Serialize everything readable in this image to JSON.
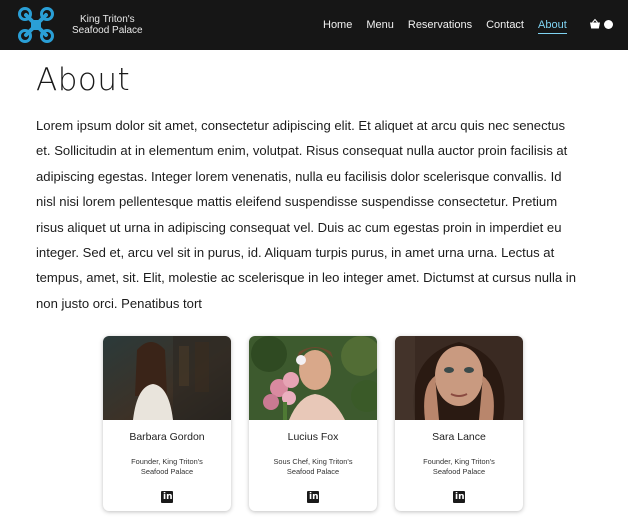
{
  "brand": {
    "line1": "King Triton's",
    "line2": "Seafood Palace",
    "logo_icon": "drone-x-icon",
    "accent_color": "#2a9fd6"
  },
  "nav": {
    "items": [
      {
        "label": "Home"
      },
      {
        "label": "Menu"
      },
      {
        "label": "Reservations"
      },
      {
        "label": "Contact"
      },
      {
        "label": "About",
        "active": true
      }
    ],
    "active_color": "#7fd3f2",
    "cart_icon": "basket-icon"
  },
  "main": {
    "title": "About",
    "body": "Lorem ipsum dolor sit amet, consectetur adipiscing elit. Et aliquet at arcu quis nec senectus et. Sollicitudin at in elementum enim, volutpat. Risus consequat nulla auctor proin facilisis at adipiscing egestas. Integer lorem venenatis, nulla eu facilisis dolor scelerisque convallis. Id nisl nisi lorem pellentesque mattis eleifend suspendisse suspendisse consectetur. Pretium risus aliquet ut urna in adipiscing consequat vel. Duis ac cum egestas proin in imperdiet eu integer. Sed et, arcu vel sit in purus, id. Aliquam turpis purus, in amet urna urna. Lectus at tempus, amet, sit. Elit, molestie ac scelerisque in leo integer amet. Dictumst at cursus nulla in non justo orci. Penatibus tort"
  },
  "team": [
    {
      "name": "Barbara Gordon",
      "role_line1": "Founder, King Triton's",
      "role_line2": "Seafood Palace",
      "icon": "linkedin-icon"
    },
    {
      "name": "Lucius Fox",
      "role_line1": "Sous Chef, King Triton's",
      "role_line2": "Seafood Palace",
      "icon": "linkedin-icon"
    },
    {
      "name": "Sara Lance",
      "role_line1": "Founder, King Triton's",
      "role_line2": "Seafood Palace",
      "icon": "linkedin-icon"
    }
  ]
}
